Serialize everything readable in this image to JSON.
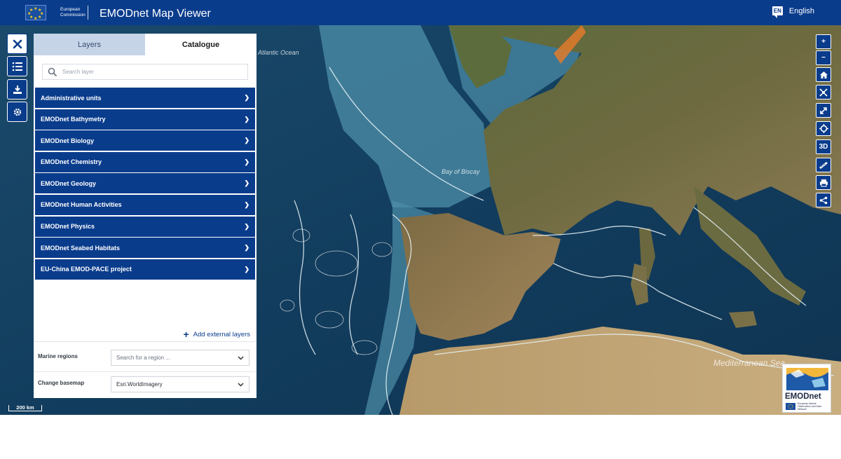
{
  "header": {
    "org_line1": "European",
    "org_line2": "Commission",
    "app_title": "EMODnet Map Viewer",
    "language_code": "EN",
    "language_label": "English",
    "bg_color": "#0a3c8c"
  },
  "rail": {
    "close_icon": "close-icon",
    "list_icon": "list-icon",
    "download_icon": "download-icon",
    "settings_icon": "gear-icon"
  },
  "panel": {
    "tabs": [
      {
        "label": "Layers",
        "active": false
      },
      {
        "label": "Catalogue",
        "active": true
      }
    ],
    "search_placeholder": "Search layer",
    "catalogue_items": [
      {
        "label": "Administrative units"
      },
      {
        "label": "EMODnet Bathymetry"
      },
      {
        "label": "EMODnet Biology"
      },
      {
        "label": "EMODnet Chemistry"
      },
      {
        "label": "EMODnet Geology"
      },
      {
        "label": "EMODnet Human Activities"
      },
      {
        "label": "EMODnet Physics"
      },
      {
        "label": "EMODnet Seabed Habitats"
      },
      {
        "label": "EU-China EMOD-PACE project"
      }
    ],
    "add_external_label": "Add external layers",
    "marine_regions_label": "Marine regions",
    "marine_regions_placeholder": "Search for a region ...",
    "basemap_label": "Change basemap",
    "basemap_value": "Esri.WorldImagery"
  },
  "map": {
    "labels": {
      "bay_of_biscay": "Bay of Biscay",
      "mediterranean_sea": "Mediterranean Sea",
      "atlantic": "Atlantic Ocean"
    },
    "scale_label": "200 km"
  },
  "toolbar": {
    "zoom_in": "+",
    "zoom_out": "−",
    "three_d": "3D",
    "icons": [
      "home-icon",
      "fit-extent-icon",
      "fullscreen-icon",
      "locate-icon",
      "measure-icon",
      "print-icon",
      "share-icon"
    ]
  },
  "logo": {
    "name": "EMODnet",
    "subtitle": "European Marine Observation and Data Network"
  }
}
